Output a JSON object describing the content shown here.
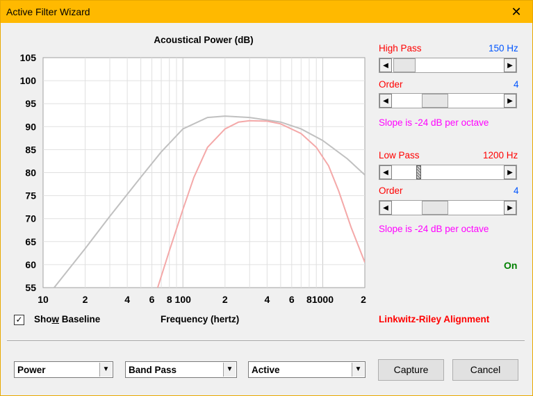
{
  "window": {
    "title": "Active Filter Wizard",
    "close_glyph": "✕"
  },
  "chart": {
    "title": "Acoustical Power (dB)",
    "xlabel": "Frequency (hertz)",
    "y_ticks": [
      "105",
      "100",
      "95",
      "90",
      "85",
      "80",
      "75",
      "70",
      "65",
      "60",
      "55"
    ],
    "x_ticks": [
      "10",
      "2",
      "4",
      "6",
      "8",
      "100",
      "2",
      "4",
      "6",
      "8",
      "1000",
      "2"
    ]
  },
  "chart_data": {
    "type": "line",
    "title": "Acoustical Power (dB)",
    "xlabel": "Frequency (hertz)",
    "ylabel": "",
    "xscale": "log",
    "xlim": [
      10,
      2000
    ],
    "ylim": [
      55,
      105
    ],
    "grid": true,
    "series": [
      {
        "color": "#c0c0c0",
        "x": [
          12,
          20,
          30,
          50,
          70,
          100,
          150,
          200,
          300,
          500,
          700,
          1000,
          1500,
          2000
        ],
        "y": [
          55,
          63.5,
          70.5,
          79,
          84.5,
          89.5,
          92,
          92.3,
          92,
          91,
          89.5,
          87,
          83,
          79.5
        ]
      },
      {
        "color": "#f4a8a8",
        "x": [
          66,
          80,
          100,
          120,
          150,
          200,
          250,
          300,
          400,
          500,
          700,
          900,
          1100,
          1300,
          1600,
          2000
        ],
        "y": [
          55,
          63,
          72,
          79,
          85.5,
          89.5,
          91,
          91.3,
          91.2,
          90.6,
          88.5,
          85.5,
          81.5,
          76,
          68,
          60.5
        ]
      }
    ]
  },
  "highpass": {
    "label": "High Pass",
    "value": "150 Hz",
    "order_label": "Order",
    "order_value": "4",
    "slope": "Slope is -24 dB per octave"
  },
  "lowpass": {
    "label": "Low Pass",
    "value": "1200 Hz",
    "order_label": "Order",
    "order_value": "4",
    "slope": "Slope is -24 dB per octave"
  },
  "status": "On",
  "baseline": {
    "label_pre": "Sho",
    "label_u": "w",
    "label_post": " Baseline",
    "checked": "✓"
  },
  "alignment": "Linkwitz-Riley Alignment",
  "dropdowns": {
    "measure": "Power",
    "type": "Band Pass",
    "mode": "Active"
  },
  "buttons": {
    "capture": "Capture",
    "cancel": "Cancel"
  }
}
